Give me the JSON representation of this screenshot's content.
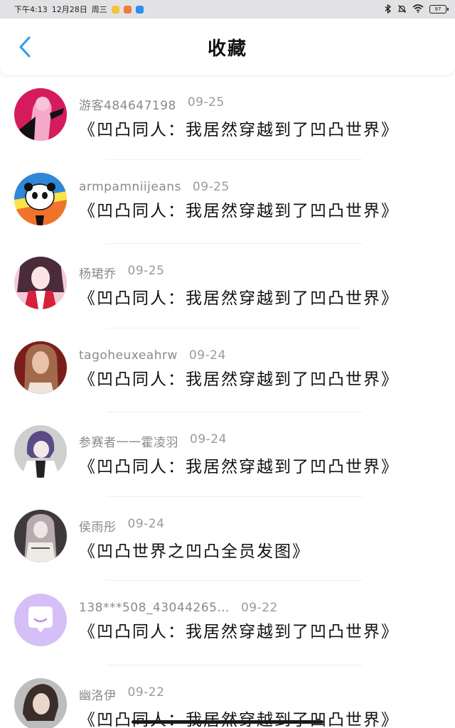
{
  "status_bar": {
    "time": "下午4:13",
    "date": "12月28日",
    "weekday": "周三",
    "battery": "97"
  },
  "header": {
    "title": "收藏",
    "back_icon": "chevron-left-icon",
    "accent_color": "#2f9bec"
  },
  "favorites": [
    {
      "user": "游客484647198",
      "date": "09-25",
      "title": "《凹凸同人：我居然穿越到了凹凸世界》"
    },
    {
      "user": "armpamniijeans",
      "date": "09-25",
      "title": "《凹凸同人：我居然穿越到了凹凸世界》"
    },
    {
      "user": "杨珺乔",
      "date": "09-25",
      "title": "《凹凸同人：我居然穿越到了凹凸世界》"
    },
    {
      "user": "tagoheuxeahrw",
      "date": "09-24",
      "title": "《凹凸同人：我居然穿越到了凹凸世界》"
    },
    {
      "user": "参赛者一一霍凌羽",
      "date": "09-24",
      "title": "《凹凸同人：我居然穿越到了凹凸世界》"
    },
    {
      "user": "侯雨彤",
      "date": "09-24",
      "title": "《凹凸世界之凹凸全员发图》"
    },
    {
      "user": "138***508_43044265…",
      "date": "09-22",
      "title": "《凹凸同人：我居然穿越到了凹凸世界》"
    },
    {
      "user": "幽洛伊",
      "date": "09-22",
      "title": "《凹凸同人：我居然穿越到了凹凸世界》"
    }
  ]
}
